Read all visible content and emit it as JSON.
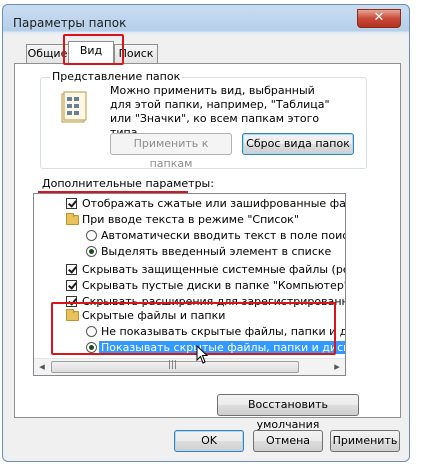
{
  "window": {
    "title": "Параметры папок",
    "close_glyph": "✕"
  },
  "tabs": [
    {
      "label": "Общие"
    },
    {
      "label": "Вид"
    },
    {
      "label": "Поиск"
    }
  ],
  "folder_view": {
    "group_title": "Представление папок",
    "description": "Можно применить вид, выбранный для этой папки, например, \"Таблица\" или \"Значки\", ко всем папкам этого типа.",
    "apply_button": "Применить к папкам",
    "reset_button": "Сброс вида папок"
  },
  "advanced": {
    "title": "Дополнительные параметры:",
    "items": [
      {
        "type": "checkbox",
        "checked": true,
        "label": "Отображать сжатые или зашифрованные файлы NTFS"
      },
      {
        "type": "folder",
        "label": "При вводе текста в режиме \"Список\""
      },
      {
        "type": "radio",
        "selected": false,
        "label": "Автоматически вводить текст в поле поиска"
      },
      {
        "type": "radio",
        "selected": true,
        "label": "Выделять введенный элемент в списке"
      },
      {
        "type": "checkbox",
        "checked": true,
        "label": "Скрывать защищенные системные файлы (рекомендуется)"
      },
      {
        "type": "checkbox",
        "checked": true,
        "label": "Скрывать пустые диски в папке \"Компьютер\""
      },
      {
        "type": "checkbox",
        "checked": true,
        "label": "Скрывать расширения для зарегистрированных типов"
      },
      {
        "type": "folder",
        "label": "Скрытые файлы и папки"
      },
      {
        "type": "radio",
        "selected": false,
        "label": "Не показывать скрытые файлы, папки и диски"
      },
      {
        "type": "radio",
        "selected": true,
        "highlighted": true,
        "label": "Показывать скрытые файлы, папки и диски"
      }
    ],
    "scroll_left": "◂",
    "scroll_right": "▸",
    "scroll_up": "▴",
    "scroll_down": "▾",
    "thumb_grip": "|||"
  },
  "restore_button": "Восстановить умолчания",
  "footer": {
    "ok": "OK",
    "cancel": "Отмена",
    "apply": "Применить"
  },
  "colors": {
    "highlight_row": "#3399ff",
    "annotation_red": "#d9151b"
  }
}
